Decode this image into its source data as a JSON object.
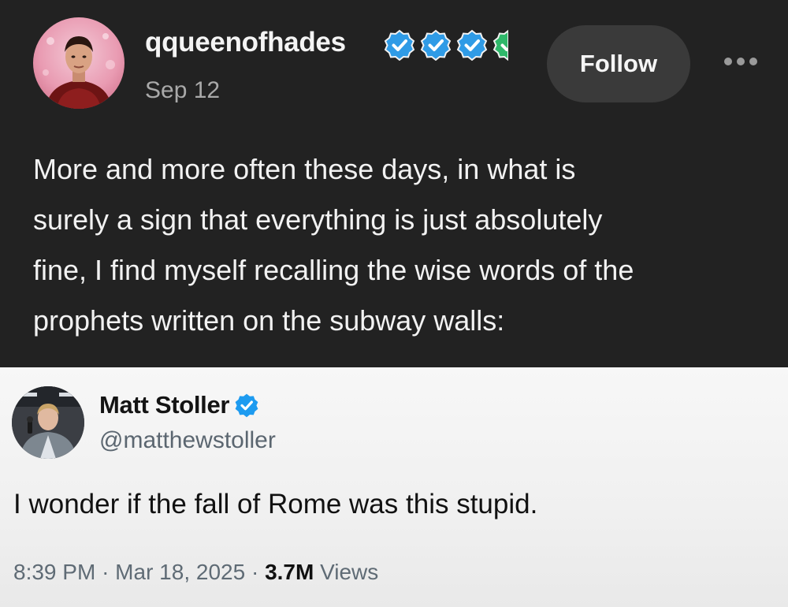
{
  "post": {
    "username": "qqueenofhades",
    "date": "Sep 12",
    "follow_label": "Follow",
    "body": "More and more often these days, in what is\nsurely a sign that everything is just absolutely\nfine, I find myself recalling the wise words of the\nprophets written on the subway walls:",
    "badge_color": "#2f9be6",
    "badge_partial_color": "#2fb86a",
    "more_icon": "ellipsis-icon"
  },
  "quoted_tweet": {
    "name": "Matt Stoller",
    "handle": "@matthewstoller",
    "text": "I wonder if the fall of Rome was this stupid.",
    "time": "8:39 PM",
    "date": "Mar 18, 2025",
    "views_count": "3.7M",
    "views_label": "Views",
    "separator": "·",
    "verified_color": "#1d9bf0"
  }
}
